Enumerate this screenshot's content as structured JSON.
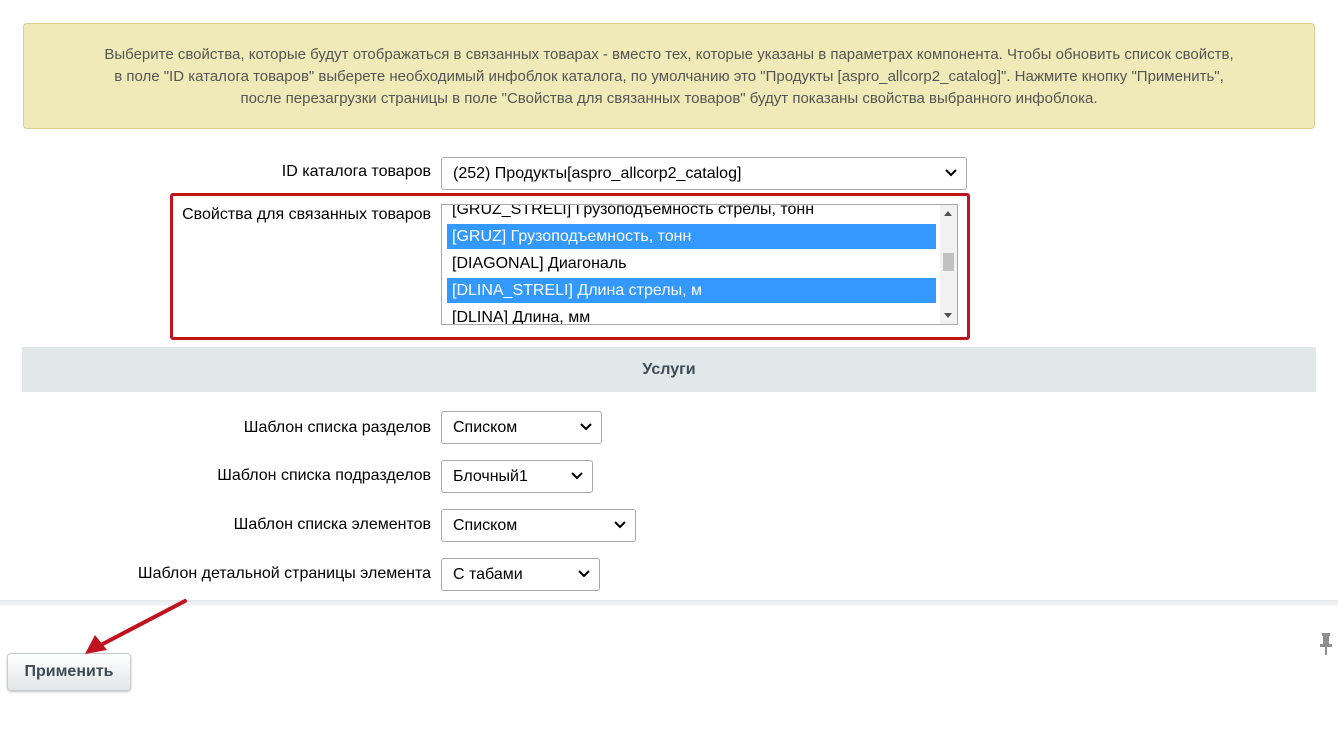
{
  "notice": {
    "lines": [
      "Выберите свойства, которые будут отображаться в связанных товарах - вместо тех, которые указаны в параметрах компонента. Чтобы обновить список свойств,",
      "в поле \"ID каталога товаров\" выберете необходимый инфоблок каталога, по умолчанию это \"Продукты [aspro_allcorp2_catalog]\". Нажмите кнопку \"Применить\",",
      "после перезагрузки страницы в поле \"Свойства для связанных товаров\" будут показаны свойства выбранного инфоблока."
    ]
  },
  "catalog": {
    "label": "ID каталога товаров",
    "value": "(252) Продукты[aspro_allcorp2_catalog]"
  },
  "properties": {
    "label": "Свойства для связанных товаров",
    "options": [
      {
        "label": "[GRUZ_STRELI] Грузоподъемность стрелы, тонн",
        "selected": false
      },
      {
        "label": "[GRUZ] Грузоподъемность, тонн",
        "selected": true
      },
      {
        "label": "[DIAGONAL] Диагональ",
        "selected": false
      },
      {
        "label": "[DLINA_STRELI] Длина стрелы, м",
        "selected": true
      },
      {
        "label": "[DLINA] Длина, мм",
        "selected": false
      }
    ]
  },
  "services": {
    "title": "Услуги",
    "fields": [
      {
        "label": "Шаблон списка разделов",
        "value": "Списком"
      },
      {
        "label": "Шаблон списка подразделов",
        "value": "Блочный1"
      },
      {
        "label": "Шаблон списка элементов",
        "value": "Списком"
      },
      {
        "label": "Шаблон детальной страницы элемента",
        "value": "С табами"
      }
    ]
  },
  "footer": {
    "apply_label": "Применить",
    "pin_icon": "pin-icon"
  },
  "colors": {
    "notice_bg": "#f0eab9",
    "highlight_border": "#c1121f",
    "selected_option": "#3399ff",
    "section_bg": "#e0e8ea",
    "arrow": "#c1121f"
  }
}
